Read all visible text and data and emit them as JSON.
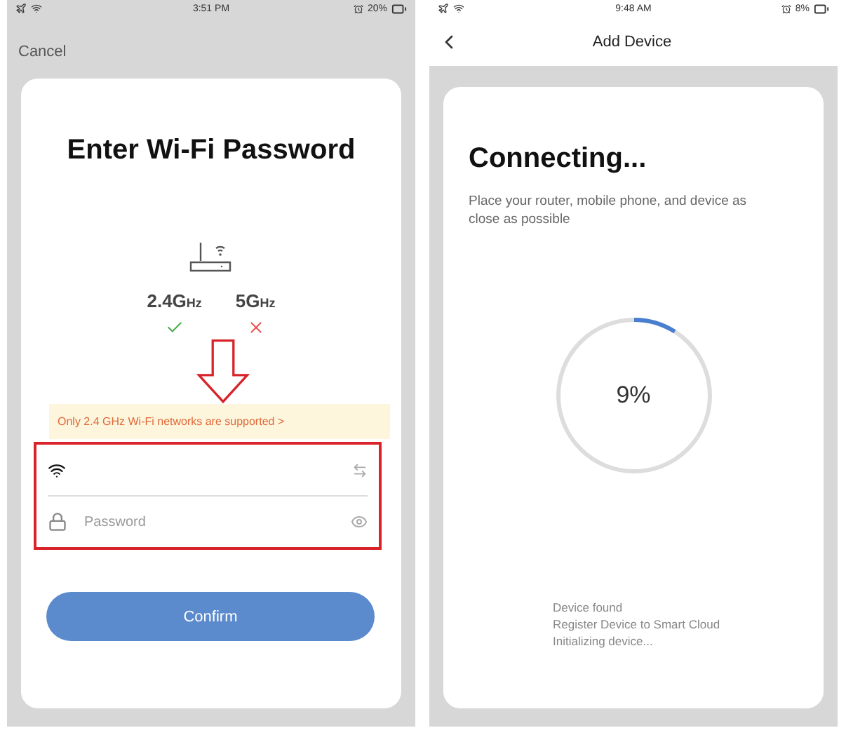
{
  "wifi_screen": {
    "status_bar": {
      "time": "3:51 PM",
      "battery": "20%"
    },
    "cancel": "Cancel",
    "title": "Enter Wi-Fi Password",
    "bands": [
      {
        "label": "2.4G",
        "unit": "Hz",
        "supported": true
      },
      {
        "label": "5G",
        "unit": "Hz",
        "supported": false
      }
    ],
    "notice": "Only 2.4 GHz Wi-Fi networks are supported >",
    "password": {
      "placeholder": "Password"
    },
    "confirm": "Confirm",
    "annotation": {
      "arrow": true,
      "highlight": true
    }
  },
  "progress_screen": {
    "status_bar": {
      "time": "9:48 AM",
      "battery": "8%"
    },
    "nav_title": "Add Device",
    "title": "Connecting...",
    "description": "Place your router, mobile phone, and device as close as possible",
    "progress": {
      "level": 0.09
    },
    "reading": "9%",
    "steps": [
      "Device found",
      "Register Device to Smart Cloud",
      "Initializing device..."
    ]
  }
}
